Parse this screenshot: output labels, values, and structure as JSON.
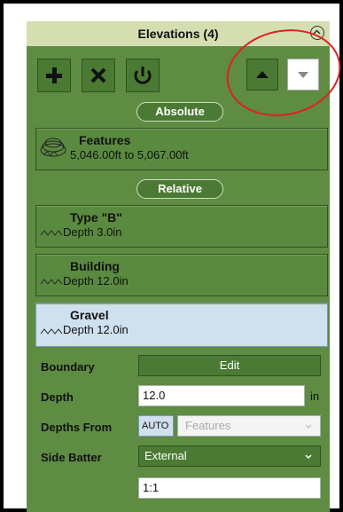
{
  "header": {
    "title": "Elevations (4)"
  },
  "toolbar": {
    "add_icon": "plus-icon",
    "delete_icon": "x-icon",
    "power_icon": "power-icon",
    "up_icon": "triangle-up-icon",
    "down_icon": "triangle-down-icon"
  },
  "sections": {
    "absolute": "Absolute",
    "relative": "Relative"
  },
  "items": [
    {
      "name": "Features",
      "sub": "5,046.00ft to 5,067.00ft"
    },
    {
      "name": "Type \"B\"",
      "sub": "Depth 3.0in"
    },
    {
      "name": "Building",
      "sub": "Depth 12.0in"
    },
    {
      "name": "Gravel",
      "sub": "Depth 12.0in"
    }
  ],
  "form": {
    "boundary_label": "Boundary",
    "edit_label": "Edit",
    "depth_label": "Depth",
    "depth_value": "12.0",
    "depth_unit": "in",
    "depths_from_label": "Depths From",
    "auto_label": "AUTO",
    "depths_from_value": "Features",
    "side_batter_label": "Side Batter",
    "side_batter_value": "External",
    "ratio_value": "1:1"
  },
  "colors": {
    "panel": "#5e8c43",
    "selected": "#cfe0ee",
    "annotation": "#e02020"
  }
}
